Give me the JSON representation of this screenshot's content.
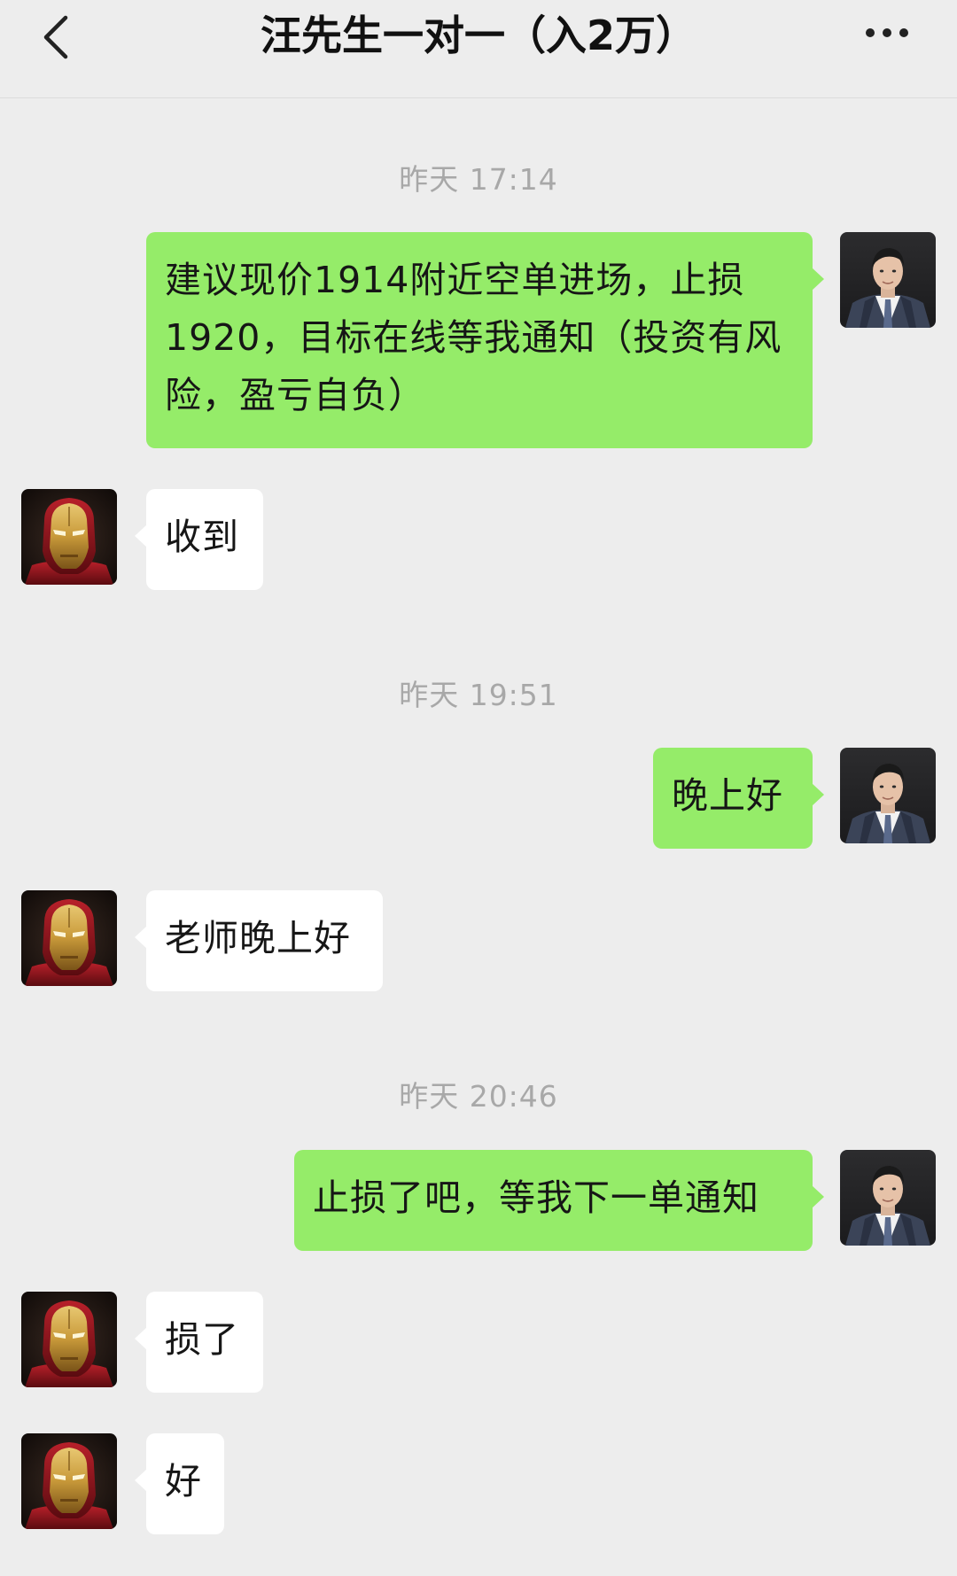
{
  "header": {
    "title": "汪先生一对一（入2万）",
    "back_icon": "chevron-left-icon",
    "more_icon": "ellipsis-icon"
  },
  "colors": {
    "background": "#ededed",
    "outgoing_bubble": "#95ec69",
    "incoming_bubble": "#ffffff",
    "timestamp_text": "#a8a8a8"
  },
  "messages": {
    "ts1": "昨天 17:14",
    "m1": "建议现价1914附近空单进场，止损1920，目标在线等我通知（投资有风险，盈亏自负）",
    "m2": "收到",
    "ts2": "昨天 19:51",
    "m3": "晚上好",
    "m4": "老师晚上好",
    "ts3": "昨天 20:46",
    "m5": "止损了吧，等我下一单通知",
    "m6": "损了",
    "m7": "好"
  }
}
